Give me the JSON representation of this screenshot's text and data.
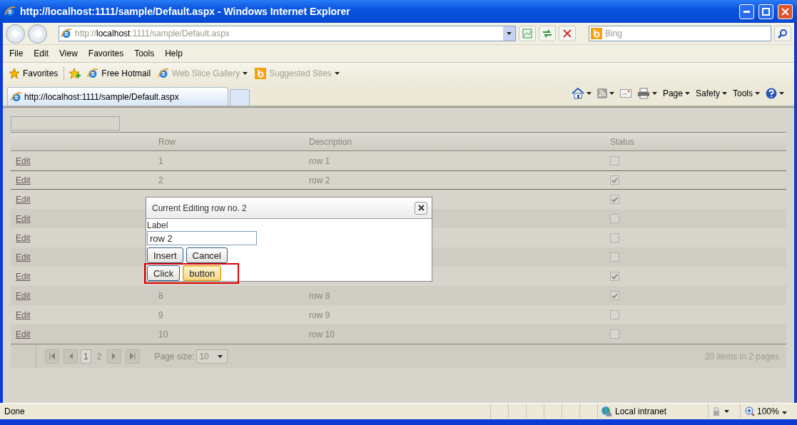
{
  "window": {
    "title": "http://localhost:1111/sample/Default.aspx - Windows Internet Explorer"
  },
  "address_bar": {
    "scheme": "http://",
    "host": "localhost",
    "path": ":1111/sample/Default.aspx"
  },
  "search": {
    "placeholder": "Bing"
  },
  "menu": [
    "File",
    "Edit",
    "View",
    "Favorites",
    "Tools",
    "Help"
  ],
  "favorites_bar": {
    "favorites": "Favorites",
    "links": [
      {
        "label": "Free Hotmail",
        "kind": "ie",
        "disabled": false,
        "dropdown": false
      },
      {
        "label": "Web Slice Gallery",
        "kind": "ie",
        "disabled": true,
        "dropdown": true
      },
      {
        "label": "Suggested Sites",
        "kind": "bing",
        "disabled": true,
        "dropdown": true
      }
    ]
  },
  "tabs": [
    {
      "label": "http://localhost:1111/sample/Default.aspx",
      "selected": true
    }
  ],
  "command_bar": [
    "Page",
    "Safety",
    "Tools"
  ],
  "grid": {
    "columns": [
      "Row",
      "Description",
      "Status"
    ],
    "rows": [
      {
        "edit": "Edit",
        "row": "1",
        "description": "row 1",
        "status": false,
        "selected": false
      },
      {
        "edit": "Edit",
        "row": "2",
        "description": "row 2",
        "status": true,
        "selected": true
      },
      {
        "edit": "Edit",
        "status": true,
        "selected": false
      },
      {
        "edit": "Edit",
        "status": false,
        "selected": false
      },
      {
        "edit": "Edit",
        "status": false,
        "selected": false
      },
      {
        "edit": "Edit",
        "status": false,
        "selected": false
      },
      {
        "edit": "Edit",
        "status": true,
        "selected": false
      },
      {
        "edit": "Edit",
        "row": "8",
        "description": "row 8",
        "status": true,
        "selected": false
      },
      {
        "edit": "Edit",
        "row": "9",
        "description": "row 9",
        "status": false,
        "selected": false
      },
      {
        "edit": "Edit",
        "row": "10",
        "description": "row 10",
        "status": false,
        "selected": false
      }
    ],
    "pager": {
      "pages": [
        {
          "label": "1",
          "selected": true
        },
        {
          "label": "2",
          "selected": false
        }
      ],
      "page_size_label": "Page size:",
      "page_size": "10",
      "summary": "20 items in 2 pages"
    }
  },
  "dialog": {
    "title": "Current Editing row no. 2",
    "field_label": "Label",
    "field_value": "row 2",
    "buttons": [
      "Insert",
      "Cancel"
    ],
    "extra_buttons": [
      {
        "label": "Click",
        "focused": false
      },
      {
        "label": "button",
        "focused": true
      }
    ],
    "highlighted": true
  },
  "status_bar": {
    "text": "Done",
    "zone": "Local intranet",
    "zoom": "100%"
  }
}
